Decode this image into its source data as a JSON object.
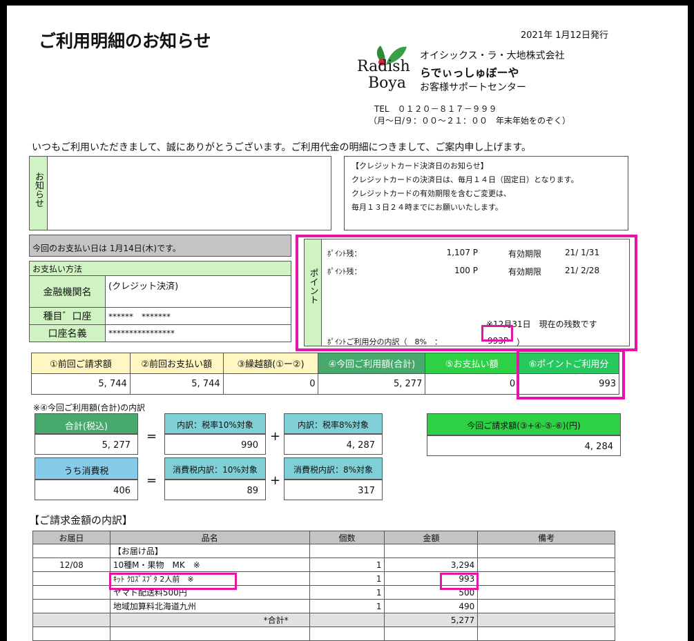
{
  "header": {
    "title": "ご利用明細のお知らせ",
    "issue_date": "2021年 1月12日発行",
    "logo_top": "Radish",
    "logo_bottom": "Boya",
    "company": "オイシックス・ラ・大地株式会社",
    "brand": "らでぃっしゅぼーや",
    "support": "お客様サポートセンター",
    "tel": "TEL　０１２０－８１７－９９９",
    "hours": "（月～日/９：００～２１：００　年末年始をのぞく）"
  },
  "greeting": "いつもご利用いただきまして、誠にありがとうございます。ご利用代金の明細につきまして、ご案内申し上げます。",
  "notice": {
    "side_label": "お知らせ",
    "credit_title": "【クレジットカード決済日のお知らせ】",
    "credit_line1": "クレジットカードの決済日は、毎月１４日（固定日）となります。",
    "credit_line2": "クレジットカードの有効期限を含むご変更は、",
    "credit_line3": "毎月１３日２４時までにお願いいたします。"
  },
  "payment_day": "今回のお支払い日は 1月14日(木)です。",
  "payment_method": {
    "title": "お支払い方法",
    "bank_label": "金融機関名",
    "bank_value": "(クレジット決済)",
    "type_label": "種目゛口座",
    "type_value": "******　*******",
    "holder_label": "口座名義",
    "holder_value": "****************"
  },
  "points": {
    "side_label": "ポイント",
    "row1_label": "ﾎﾟｲﾝﾄ残：",
    "row1_value": "1,107 P",
    "row1_exp_label": "有効期限",
    "row1_exp_value": "21/ 1/31",
    "row2_label": "ﾎﾟｲﾝﾄ残：",
    "row2_value": "100 P",
    "row2_exp_label": "有効期限",
    "row2_exp_value": "21/ 2/28",
    "note": "※12月31日　現在の残数です",
    "usage_label": "ﾎﾟｲﾝﾄご利用分の内訳（　8%　：",
    "usage_value": "993P",
    "usage_close": "）"
  },
  "summary": {
    "headers": [
      "①前回ご請求額",
      "②前回お支払い額",
      "③繰越額(①ー②)",
      "④今回ご利用額(合計)",
      "⑤お支払い額",
      "⑥ポイントご利用分"
    ],
    "values": [
      "5, 744",
      "5, 744",
      "0",
      "5, 277",
      "0",
      "993"
    ]
  },
  "breakdown": {
    "title": "※④今回ご利用額(合計)の内訳",
    "total_label": "合計(税込)",
    "total_value": "5, 277",
    "eq": "=",
    "plus": "+",
    "r10_label": "内訳：税率10%対象",
    "r10_value": "990",
    "r8_label": "内訳：税率8%対象",
    "r8_value": "4, 287",
    "tax_label": "うち消費税",
    "tax_value": "406",
    "tax10_label": "消費税内訳：10%対象",
    "tax10_value": "89",
    "tax8_label": "消費税内訳：8%対象",
    "tax8_value": "317",
    "billing_label": "今回ご請求額(③+④-⑤-⑥)(円)",
    "billing_value": "4, 284"
  },
  "details": {
    "title": "【ご請求金額の内訳】",
    "headers": [
      "お届日",
      "品名",
      "個数",
      "金額",
      "備考"
    ],
    "rows": [
      {
        "date": "",
        "name": "【お届け品】",
        "qty": "",
        "amount": "",
        "note": ""
      },
      {
        "date": "12/08",
        "name": "10種M・果物　MK　※",
        "qty": "1",
        "amount": "3,294",
        "note": ""
      },
      {
        "date": "",
        "name": "ｷｯﾄ ｸﾛｽﾞｽﾌﾞﾀ 2人前　※",
        "qty": "1",
        "amount": "993",
        "note": ""
      },
      {
        "date": "",
        "name": "ヤマト配送料500円",
        "qty": "1",
        "amount": "500",
        "note": ""
      },
      {
        "date": "",
        "name": "地域加算料北海道九州",
        "qty": "1",
        "amount": "490",
        "note": ""
      },
      {
        "date": "",
        "name": "*合計*",
        "qty": "",
        "amount": "5,277",
        "note": ""
      }
    ]
  },
  "colors": {
    "highlight": "#e613a9",
    "light_green": "#cff3c3",
    "yellow": "#fff6c2"
  }
}
